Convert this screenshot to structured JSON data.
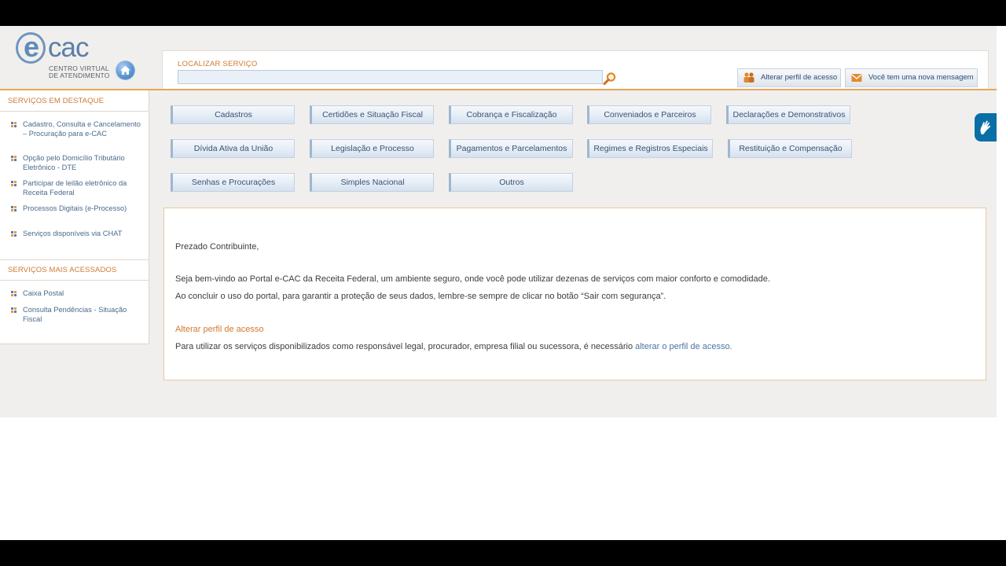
{
  "logo": {
    "e_letter": "e",
    "wordmark": "cac",
    "subtitle_line1": "CENTRO VIRTUAL",
    "subtitle_line2": "DE ATENDIMENTO"
  },
  "header": {
    "search_label": "LOCALIZAR SERVIÇO",
    "search_value": "",
    "alterar_perfil_label": "Alterar perfil de acesso",
    "mensagem_label": "Você tem uma nova mensagem"
  },
  "sidebar": {
    "destaque_title": "SERVIÇOS EM DESTAQUE",
    "destaque_items": [
      {
        "label": "Cadastro, Consulta e Cancelamento – Procuração para e-CAC"
      },
      {
        "label": "Opção pelo Domicílio Tributário Eletrônico - DTE"
      },
      {
        "label": "Participar de leilão eletrônico da Receita Federal"
      },
      {
        "label": "Processos Digitais (e-Processo)"
      },
      {
        "label": "Serviços disponíveis via CHAT"
      }
    ],
    "acessados_title": "SERVIÇOS MAIS ACESSADOS",
    "acessados_items": [
      {
        "label": "Caixa Postal"
      },
      {
        "label": "Consulta Pendências - Situação Fiscal"
      }
    ]
  },
  "categories": [
    {
      "label": "Cadastros"
    },
    {
      "label": "Certidões e Situação Fiscal"
    },
    {
      "label": "Cobrança e Fiscalização"
    },
    {
      "label": "Conveniados e Parceiros"
    },
    {
      "label": "Declarações e Demonstrativos"
    },
    {
      "label": "Dívida Ativa da União"
    },
    {
      "label": "Legislação e Processo"
    },
    {
      "label": "Pagamentos e Parcelamentos"
    },
    {
      "label": "Regimes e Registros Especiais"
    },
    {
      "label": "Restituição e Compensação"
    },
    {
      "label": "Senhas e Procurações"
    },
    {
      "label": "Simples Nacional"
    },
    {
      "label": "Outros"
    }
  ],
  "welcome": {
    "greeting": "Prezado Contribuinte,",
    "para1": "Seja bem-vindo ao Portal e-CAC da Receita Federal, um ambiente seguro, onde você pode utilizar dezenas de serviços com maior conforto e comodidade.",
    "para2": "Ao concluir o uso do portal, para garantir a proteção de seus dados, lembre-se sempre de clicar no botão “Sair com segurança”.",
    "heading": "Alterar perfil de acesso",
    "para3": "Para utilizar os serviços disponibilizados como responsável legal, procurador, empresa filial ou sucessora, é necessário ",
    "link": "alterar o perfil de acesso."
  },
  "colors": {
    "accent_orange": "#d07a32",
    "link_blue": "#4d74a4",
    "page_bg": "#f1efed"
  },
  "icons": {
    "home": "home-icon",
    "search": "magnifier-icon",
    "alterar_perfil": "users-icon",
    "mensagem": "envelope-icon",
    "accessibility": "sign-language-hands-icon"
  }
}
